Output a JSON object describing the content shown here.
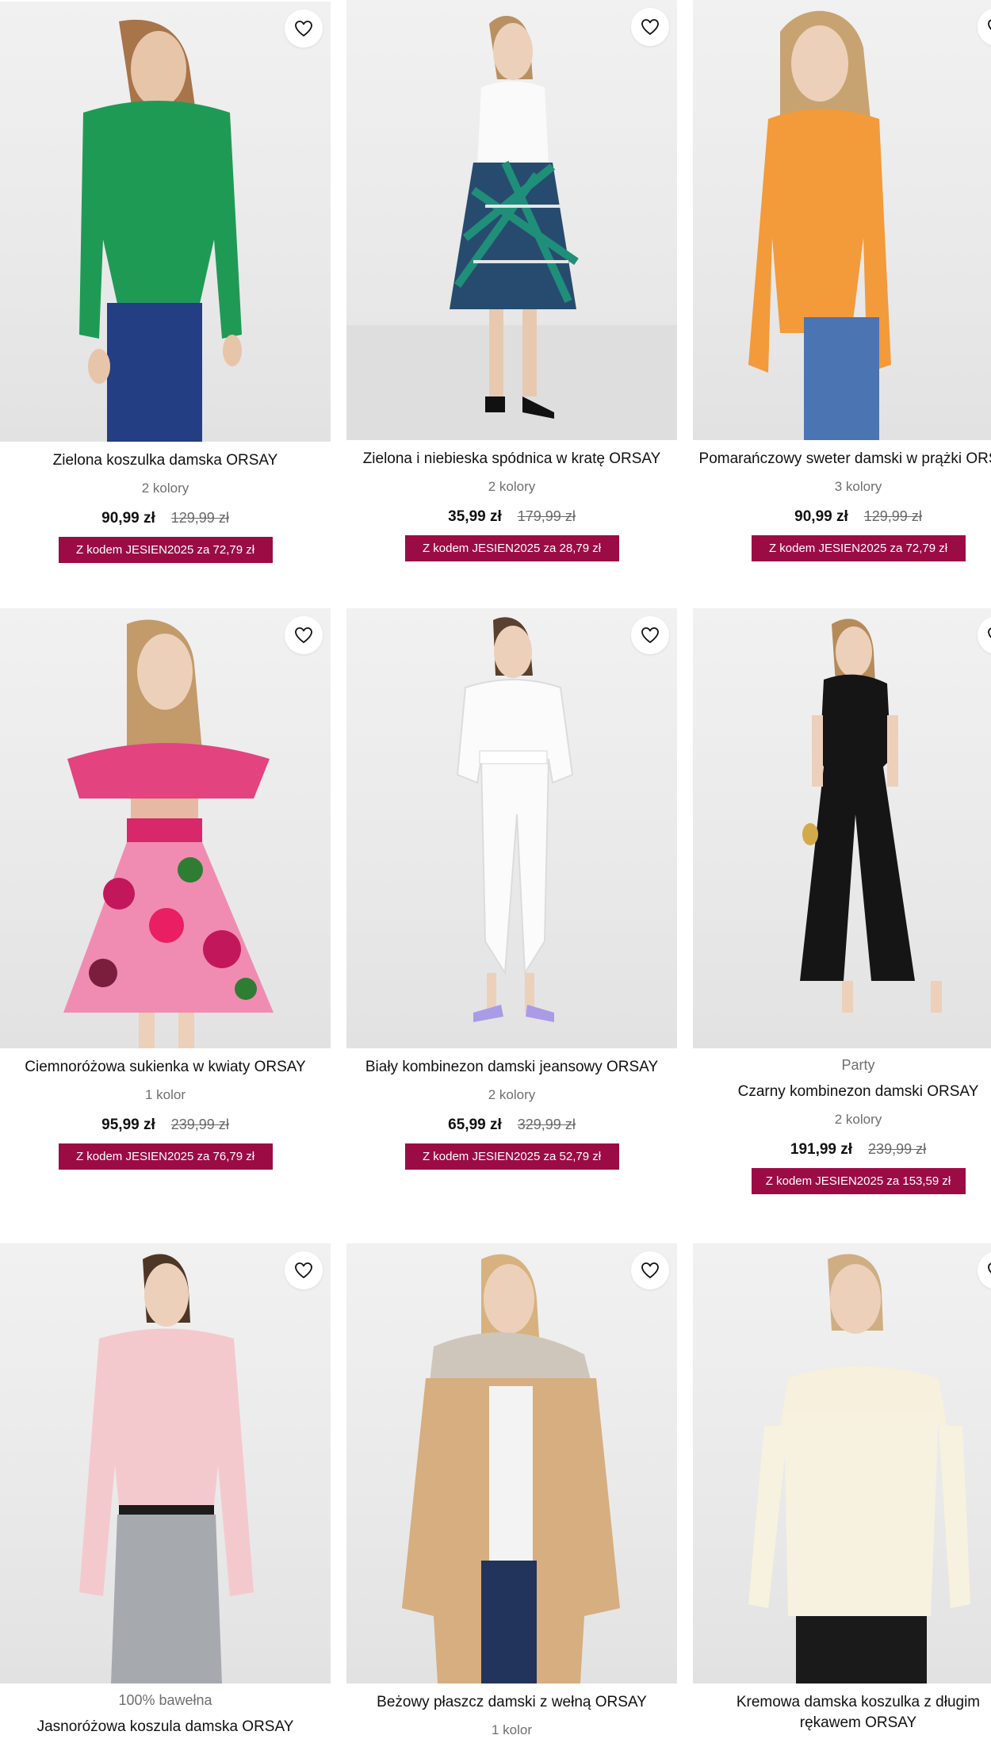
{
  "colors": {
    "promo_bg": "#9b0c45",
    "image_bg": "#ededed"
  },
  "products": [
    {
      "title": "Zielona koszulka damska ORSAY",
      "colors": "2 kolory",
      "price": "90,99 zł",
      "old_price": "129,99 zł",
      "promo": "Z kodem JESIEN2025 za 72,79 zł",
      "image": "woman-green-ribbed-top-jeans",
      "icon": "heart-icon"
    },
    {
      "title": "Zielona i niebieska spódnica w kratę ORSAY",
      "colors": "2 kolory",
      "price": "35,99 zł",
      "old_price": "179,99 zł",
      "promo": "Z kodem JESIEN2025 za 28,79 zł",
      "image": "woman-white-top-plaid-skirt",
      "icon": "heart-icon"
    },
    {
      "title": "Pomarańczowy sweter damski w prążki ORSAY",
      "colors": "3 kolory",
      "price": "90,99 zł",
      "old_price": "129,99 zł",
      "promo": "Z kodem JESIEN2025 za 72,79 zł",
      "image": "woman-orange-ribbed-sweater",
      "icon": "heart-icon"
    },
    {
      "title": "Ciemnoróżowa sukienka w kwiaty ORSAY",
      "colors": "1 kolor",
      "price": "95,99 zł",
      "old_price": "239,99 zł",
      "promo": "Z kodem JESIEN2025 za 76,79 zł",
      "image": "woman-pink-floral-dress",
      "icon": "heart-icon"
    },
    {
      "title": "Biały kombinezon damski jeansowy ORSAY",
      "colors": "2 kolory",
      "price": "65,99 zł",
      "old_price": "329,99 zł",
      "promo": "Z kodem JESIEN2025 za 52,79 zł",
      "image": "woman-white-denim-jumpsuit",
      "icon": "heart-icon"
    },
    {
      "tag": "Party",
      "title": "Czarny kombinezon damski ORSAY",
      "colors": "2 kolory",
      "price": "191,99 zł",
      "old_price": "239,99 zł",
      "promo": "Z kodem JESIEN2025 za 153,59 zł",
      "image": "woman-black-jumpsuit",
      "icon": "heart-icon"
    },
    {
      "tag": "100% bawełna",
      "title": "Jasnoróżowa koszula damska ORSAY",
      "image": "woman-light-pink-shirt",
      "icon": "heart-icon"
    },
    {
      "title": "Beżowy płaszcz damski z wełną ORSAY",
      "colors": "1 kolor",
      "image": "woman-beige-coat-fur-collar",
      "icon": "heart-icon"
    },
    {
      "title": "Kremowa damska koszulka z długim rękawem ORSAY",
      "image": "woman-cream-off-shoulder-top",
      "icon": "heart-icon"
    }
  ]
}
